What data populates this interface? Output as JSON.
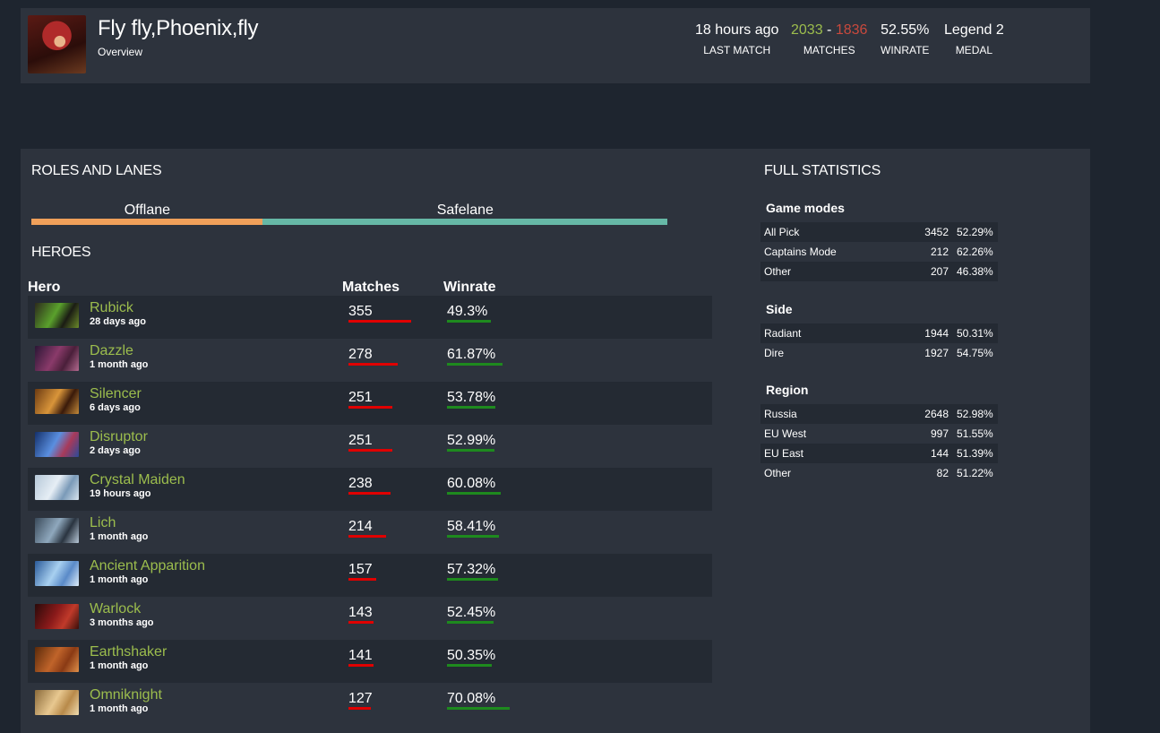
{
  "header": {
    "player_name": "Fly fly,Phoenix,fly",
    "subtitle": "Overview",
    "last_match": {
      "value": "18 hours ago",
      "label": "LAST MATCH"
    },
    "matches": {
      "wins": "2033",
      "separator": "-",
      "losses": "1836",
      "label": "MATCHES"
    },
    "winrate": {
      "value": "52.55%",
      "label": "WINRATE"
    },
    "medal": {
      "value": "Legend 2",
      "label": "MEDAL"
    }
  },
  "roles": {
    "title": "ROLES AND LANES",
    "lanes": [
      {
        "name": "Offlane",
        "share": 0.364,
        "color": "#f0a05a"
      },
      {
        "name": "Safelane",
        "share": 0.636,
        "color": "#66b8a6"
      }
    ]
  },
  "heroes": {
    "title": "HEROES",
    "columns": {
      "hero": "Hero",
      "matches": "Matches",
      "winrate": "Winrate"
    },
    "rows": [
      {
        "name": "Rubick",
        "last_played": "28 days ago",
        "matches": "355",
        "winrate": "49.3%",
        "matches_share": 1.0,
        "winrate_share": 0.703,
        "portrait_icon": "rubick-portrait"
      },
      {
        "name": "Dazzle",
        "last_played": "1 month ago",
        "matches": "278",
        "winrate": "61.87%",
        "matches_share": 0.783,
        "winrate_share": 0.883,
        "portrait_icon": "dazzle-portrait"
      },
      {
        "name": "Silencer",
        "last_played": "6 days ago",
        "matches": "251",
        "winrate": "53.78%",
        "matches_share": 0.707,
        "winrate_share": 0.767,
        "portrait_icon": "silencer-portrait"
      },
      {
        "name": "Disruptor",
        "last_played": "2 days ago",
        "matches": "251",
        "winrate": "52.99%",
        "matches_share": 0.707,
        "winrate_share": 0.756,
        "portrait_icon": "disruptor-portrait"
      },
      {
        "name": "Crystal Maiden",
        "last_played": "19 hours ago",
        "matches": "238",
        "winrate": "60.08%",
        "matches_share": 0.67,
        "winrate_share": 0.857,
        "portrait_icon": "crystal-maiden-portrait"
      },
      {
        "name": "Lich",
        "last_played": "1 month ago",
        "matches": "214",
        "winrate": "58.41%",
        "matches_share": 0.603,
        "winrate_share": 0.833,
        "portrait_icon": "lich-portrait"
      },
      {
        "name": "Ancient Apparition",
        "last_played": "1 month ago",
        "matches": "157",
        "winrate": "57.32%",
        "matches_share": 0.442,
        "winrate_share": 0.818,
        "portrait_icon": "ancient-apparition-portrait"
      },
      {
        "name": "Warlock",
        "last_played": "3 months ago",
        "matches": "143",
        "winrate": "52.45%",
        "matches_share": 0.403,
        "winrate_share": 0.748,
        "portrait_icon": "warlock-portrait"
      },
      {
        "name": "Earthshaker",
        "last_played": "1 month ago",
        "matches": "141",
        "winrate": "50.35%",
        "matches_share": 0.397,
        "winrate_share": 0.718,
        "portrait_icon": "earthshaker-portrait"
      },
      {
        "name": "Omniknight",
        "last_played": "1 month ago",
        "matches": "127",
        "winrate": "70.08%",
        "matches_share": 0.358,
        "winrate_share": 1.0,
        "portrait_icon": "omniknight-portrait"
      }
    ]
  },
  "full_statistics": {
    "title": "FULL STATISTICS",
    "groups": [
      {
        "title": "Game modes",
        "rows": [
          {
            "name": "All Pick",
            "count": "3452",
            "winrate": "52.29%"
          },
          {
            "name": "Captains Mode",
            "count": "212",
            "winrate": "62.26%"
          },
          {
            "name": "Other",
            "count": "207",
            "winrate": "46.38%"
          }
        ]
      },
      {
        "title": "Side",
        "rows": [
          {
            "name": "Radiant",
            "count": "1944",
            "winrate": "50.31%"
          },
          {
            "name": "Dire",
            "count": "1927",
            "winrate": "54.75%"
          }
        ]
      },
      {
        "title": "Region",
        "rows": [
          {
            "name": "Russia",
            "count": "2648",
            "winrate": "52.98%"
          },
          {
            "name": "EU West",
            "count": "997",
            "winrate": "51.55%"
          },
          {
            "name": "EU East",
            "count": "144",
            "winrate": "51.39%"
          },
          {
            "name": "Other",
            "count": "82",
            "winrate": "51.22%"
          }
        ]
      }
    ]
  },
  "colors": {
    "background": "#1e252f",
    "panel": "#2d333d",
    "row_alt": "#242a33",
    "hero_name": "#9cbd4d",
    "wins": "#9cbd4d",
    "losses": "#c9493d",
    "matches_bar": "#e00000",
    "winrate_bar": "#1e8a1e"
  }
}
